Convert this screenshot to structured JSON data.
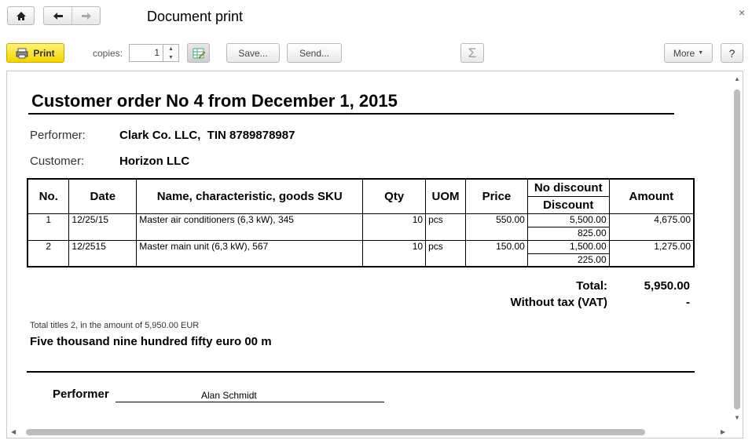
{
  "window": {
    "title": "Document print",
    "close_glyph": "×"
  },
  "nav": {
    "home_icon": "home-icon",
    "back_icon": "arrow-left-icon",
    "forward_icon": "arrow-right-icon"
  },
  "toolbar": {
    "print_label": "Print",
    "copies_label": "copies:",
    "copies_value": "1",
    "save_label": "Save...",
    "send_label": "Send...",
    "sum_glyph": "Σ",
    "more_label": "More",
    "help_label": "?"
  },
  "document": {
    "title": "Customer order No 4 from December 1, 2015",
    "performer_label": "Performer:",
    "performer_value": "Clark Co. LLC,  TIN 8789878987",
    "customer_label": "Customer:",
    "customer_value": "Horizon LLC",
    "table": {
      "headers": {
        "no": "No.",
        "date": "Date",
        "name": "Name, characteristic, goods SKU",
        "qty": "Qty",
        "uom": "UOM",
        "price": "Price",
        "no_discount": "No discount",
        "discount": "Discount",
        "amount": "Amount"
      },
      "rows": [
        {
          "no": "1",
          "date": "12/25/15",
          "name": "Master air conditioners (6,3 kW), 345",
          "qty": "10",
          "uom": "pcs",
          "price": "550.00",
          "no_discount": "5,500.00",
          "discount": "825.00",
          "amount": "4,675.00"
        },
        {
          "no": "2",
          "date": "12/2515",
          "name": "Master main unit (6,3 kW), 567",
          "qty": "10",
          "uom": "pcs",
          "price": "150.00",
          "no_discount": "1,500.00",
          "discount": "225.00",
          "amount": "1,275.00"
        }
      ]
    },
    "total_label": "Total:",
    "total_value": "5,950.00",
    "vat_label": "Without tax (VAT)",
    "vat_value": "-",
    "summary_small": "Total titles 2, in the amount of 5,950.00 EUR",
    "summary_words": "Five thousand nine hundred fifty euro 00 m",
    "signature_label": "Performer",
    "signature_name": "Alan Schmidt"
  }
}
